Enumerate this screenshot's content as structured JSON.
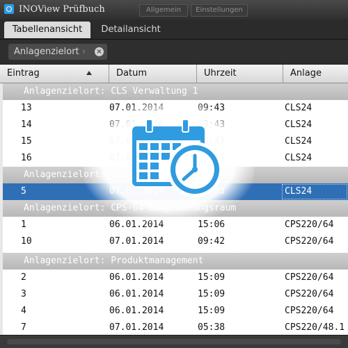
{
  "window": {
    "title": "INOView Prüfbuch",
    "toolbar_buttons": [
      "Allgemein",
      "Einstellungen"
    ]
  },
  "tabs": [
    {
      "label": "Tabellenansicht",
      "active": true
    },
    {
      "label": "Detailansicht",
      "active": false
    }
  ],
  "grouping": {
    "chip_label": "Anlagenzielort"
  },
  "columns": [
    {
      "label": "Eintrag",
      "sorted": "ascending"
    },
    {
      "label": "Datum"
    },
    {
      "label": "Uhrzeit"
    },
    {
      "label": "Anlage"
    }
  ],
  "groups": [
    {
      "label": "Anlagenzielort: CLS Verwaltung 1",
      "rows": [
        {
          "eintrag": "13",
          "datum": "07.01.2014",
          "uhrzeit": "09:43",
          "anlage": "CLS24"
        },
        {
          "eintrag": "14",
          "datum": "07.01.2014",
          "uhrzeit": "09:43",
          "anlage": "CLS24"
        },
        {
          "eintrag": "15",
          "datum": "07.01.2014",
          "uhrzeit": "09:43",
          "anlage": "CLS24"
        },
        {
          "eintrag": "16",
          "datum": "07.01.2014",
          "uhrzeit": "09:43",
          "anlage": "CLS24"
        }
      ]
    },
    {
      "label": "Anlagenzielort: CLS Verwaltung 2",
      "rows": [
        {
          "eintrag": "5",
          "datum": "07.01.2014",
          "uhrzeit": "09:43",
          "anlage": "CLS24",
          "selected": true
        }
      ]
    },
    {
      "label": "Anlagenzielort: CPS-64-Besprechungsraum",
      "rows": [
        {
          "eintrag": "1",
          "datum": "06.01.2014",
          "uhrzeit": "15:06",
          "anlage": "CPS220/64"
        },
        {
          "eintrag": "10",
          "datum": "07.01.2014",
          "uhrzeit": "09:42",
          "anlage": "CPS220/64"
        }
      ]
    },
    {
      "label": "Anlagenzielort: Produktmanagement",
      "rows": [
        {
          "eintrag": "2",
          "datum": "06.01.2014",
          "uhrzeit": "15:09",
          "anlage": "CPS220/64"
        },
        {
          "eintrag": "3",
          "datum": "06.01.2014",
          "uhrzeit": "15:09",
          "anlage": "CPS220/64"
        },
        {
          "eintrag": "4",
          "datum": "06.01.2014",
          "uhrzeit": "15:09",
          "anlage": "CPS220/64"
        },
        {
          "eintrag": "7",
          "datum": "07.01.2014",
          "uhrzeit": "05:38",
          "anlage": "CPS220/48.1"
        }
      ]
    }
  ],
  "overlay_icon": "calendar-clock-icon",
  "colors": {
    "accent_blue": "#2f9be0",
    "selection_blue": "#2f6fb6",
    "group_header": "#c4c4c4"
  }
}
